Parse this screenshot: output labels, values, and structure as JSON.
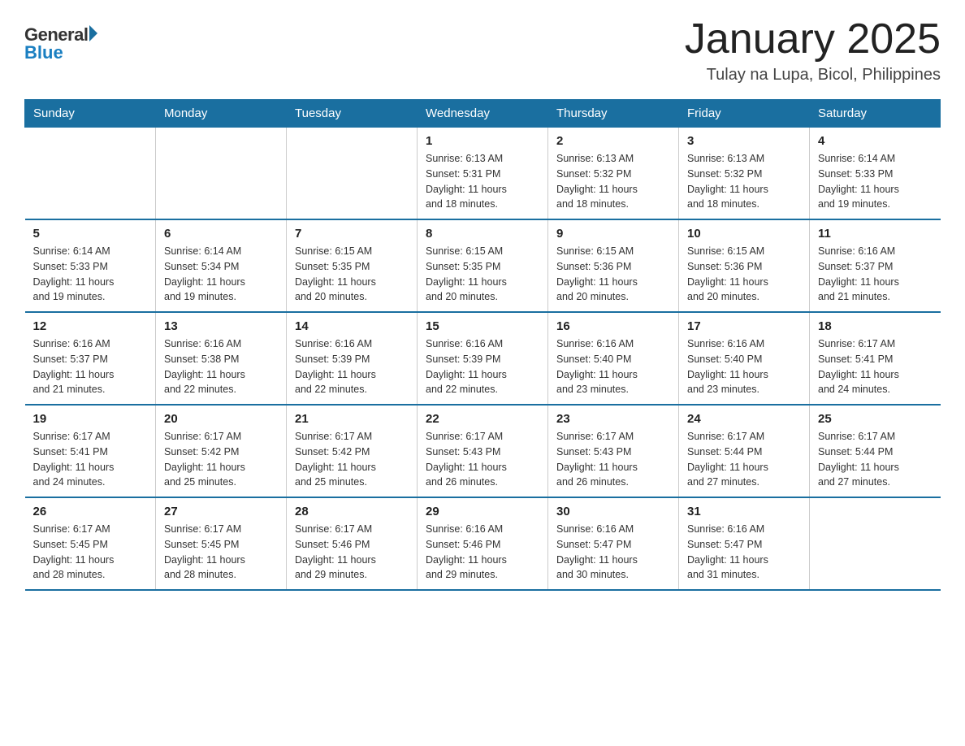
{
  "logo": {
    "general": "General",
    "blue": "Blue"
  },
  "title": "January 2025",
  "location": "Tulay na Lupa, Bicol, Philippines",
  "headers": [
    "Sunday",
    "Monday",
    "Tuesday",
    "Wednesday",
    "Thursday",
    "Friday",
    "Saturday"
  ],
  "weeks": [
    [
      {
        "day": "",
        "info": ""
      },
      {
        "day": "",
        "info": ""
      },
      {
        "day": "",
        "info": ""
      },
      {
        "day": "1",
        "info": "Sunrise: 6:13 AM\nSunset: 5:31 PM\nDaylight: 11 hours\nand 18 minutes."
      },
      {
        "day": "2",
        "info": "Sunrise: 6:13 AM\nSunset: 5:32 PM\nDaylight: 11 hours\nand 18 minutes."
      },
      {
        "day": "3",
        "info": "Sunrise: 6:13 AM\nSunset: 5:32 PM\nDaylight: 11 hours\nand 18 minutes."
      },
      {
        "day": "4",
        "info": "Sunrise: 6:14 AM\nSunset: 5:33 PM\nDaylight: 11 hours\nand 19 minutes."
      }
    ],
    [
      {
        "day": "5",
        "info": "Sunrise: 6:14 AM\nSunset: 5:33 PM\nDaylight: 11 hours\nand 19 minutes."
      },
      {
        "day": "6",
        "info": "Sunrise: 6:14 AM\nSunset: 5:34 PM\nDaylight: 11 hours\nand 19 minutes."
      },
      {
        "day": "7",
        "info": "Sunrise: 6:15 AM\nSunset: 5:35 PM\nDaylight: 11 hours\nand 20 minutes."
      },
      {
        "day": "8",
        "info": "Sunrise: 6:15 AM\nSunset: 5:35 PM\nDaylight: 11 hours\nand 20 minutes."
      },
      {
        "day": "9",
        "info": "Sunrise: 6:15 AM\nSunset: 5:36 PM\nDaylight: 11 hours\nand 20 minutes."
      },
      {
        "day": "10",
        "info": "Sunrise: 6:15 AM\nSunset: 5:36 PM\nDaylight: 11 hours\nand 20 minutes."
      },
      {
        "day": "11",
        "info": "Sunrise: 6:16 AM\nSunset: 5:37 PM\nDaylight: 11 hours\nand 21 minutes."
      }
    ],
    [
      {
        "day": "12",
        "info": "Sunrise: 6:16 AM\nSunset: 5:37 PM\nDaylight: 11 hours\nand 21 minutes."
      },
      {
        "day": "13",
        "info": "Sunrise: 6:16 AM\nSunset: 5:38 PM\nDaylight: 11 hours\nand 22 minutes."
      },
      {
        "day": "14",
        "info": "Sunrise: 6:16 AM\nSunset: 5:39 PM\nDaylight: 11 hours\nand 22 minutes."
      },
      {
        "day": "15",
        "info": "Sunrise: 6:16 AM\nSunset: 5:39 PM\nDaylight: 11 hours\nand 22 minutes."
      },
      {
        "day": "16",
        "info": "Sunrise: 6:16 AM\nSunset: 5:40 PM\nDaylight: 11 hours\nand 23 minutes."
      },
      {
        "day": "17",
        "info": "Sunrise: 6:16 AM\nSunset: 5:40 PM\nDaylight: 11 hours\nand 23 minutes."
      },
      {
        "day": "18",
        "info": "Sunrise: 6:17 AM\nSunset: 5:41 PM\nDaylight: 11 hours\nand 24 minutes."
      }
    ],
    [
      {
        "day": "19",
        "info": "Sunrise: 6:17 AM\nSunset: 5:41 PM\nDaylight: 11 hours\nand 24 minutes."
      },
      {
        "day": "20",
        "info": "Sunrise: 6:17 AM\nSunset: 5:42 PM\nDaylight: 11 hours\nand 25 minutes."
      },
      {
        "day": "21",
        "info": "Sunrise: 6:17 AM\nSunset: 5:42 PM\nDaylight: 11 hours\nand 25 minutes."
      },
      {
        "day": "22",
        "info": "Sunrise: 6:17 AM\nSunset: 5:43 PM\nDaylight: 11 hours\nand 26 minutes."
      },
      {
        "day": "23",
        "info": "Sunrise: 6:17 AM\nSunset: 5:43 PM\nDaylight: 11 hours\nand 26 minutes."
      },
      {
        "day": "24",
        "info": "Sunrise: 6:17 AM\nSunset: 5:44 PM\nDaylight: 11 hours\nand 27 minutes."
      },
      {
        "day": "25",
        "info": "Sunrise: 6:17 AM\nSunset: 5:44 PM\nDaylight: 11 hours\nand 27 minutes."
      }
    ],
    [
      {
        "day": "26",
        "info": "Sunrise: 6:17 AM\nSunset: 5:45 PM\nDaylight: 11 hours\nand 28 minutes."
      },
      {
        "day": "27",
        "info": "Sunrise: 6:17 AM\nSunset: 5:45 PM\nDaylight: 11 hours\nand 28 minutes."
      },
      {
        "day": "28",
        "info": "Sunrise: 6:17 AM\nSunset: 5:46 PM\nDaylight: 11 hours\nand 29 minutes."
      },
      {
        "day": "29",
        "info": "Sunrise: 6:16 AM\nSunset: 5:46 PM\nDaylight: 11 hours\nand 29 minutes."
      },
      {
        "day": "30",
        "info": "Sunrise: 6:16 AM\nSunset: 5:47 PM\nDaylight: 11 hours\nand 30 minutes."
      },
      {
        "day": "31",
        "info": "Sunrise: 6:16 AM\nSunset: 5:47 PM\nDaylight: 11 hours\nand 31 minutes."
      },
      {
        "day": "",
        "info": ""
      }
    ]
  ]
}
